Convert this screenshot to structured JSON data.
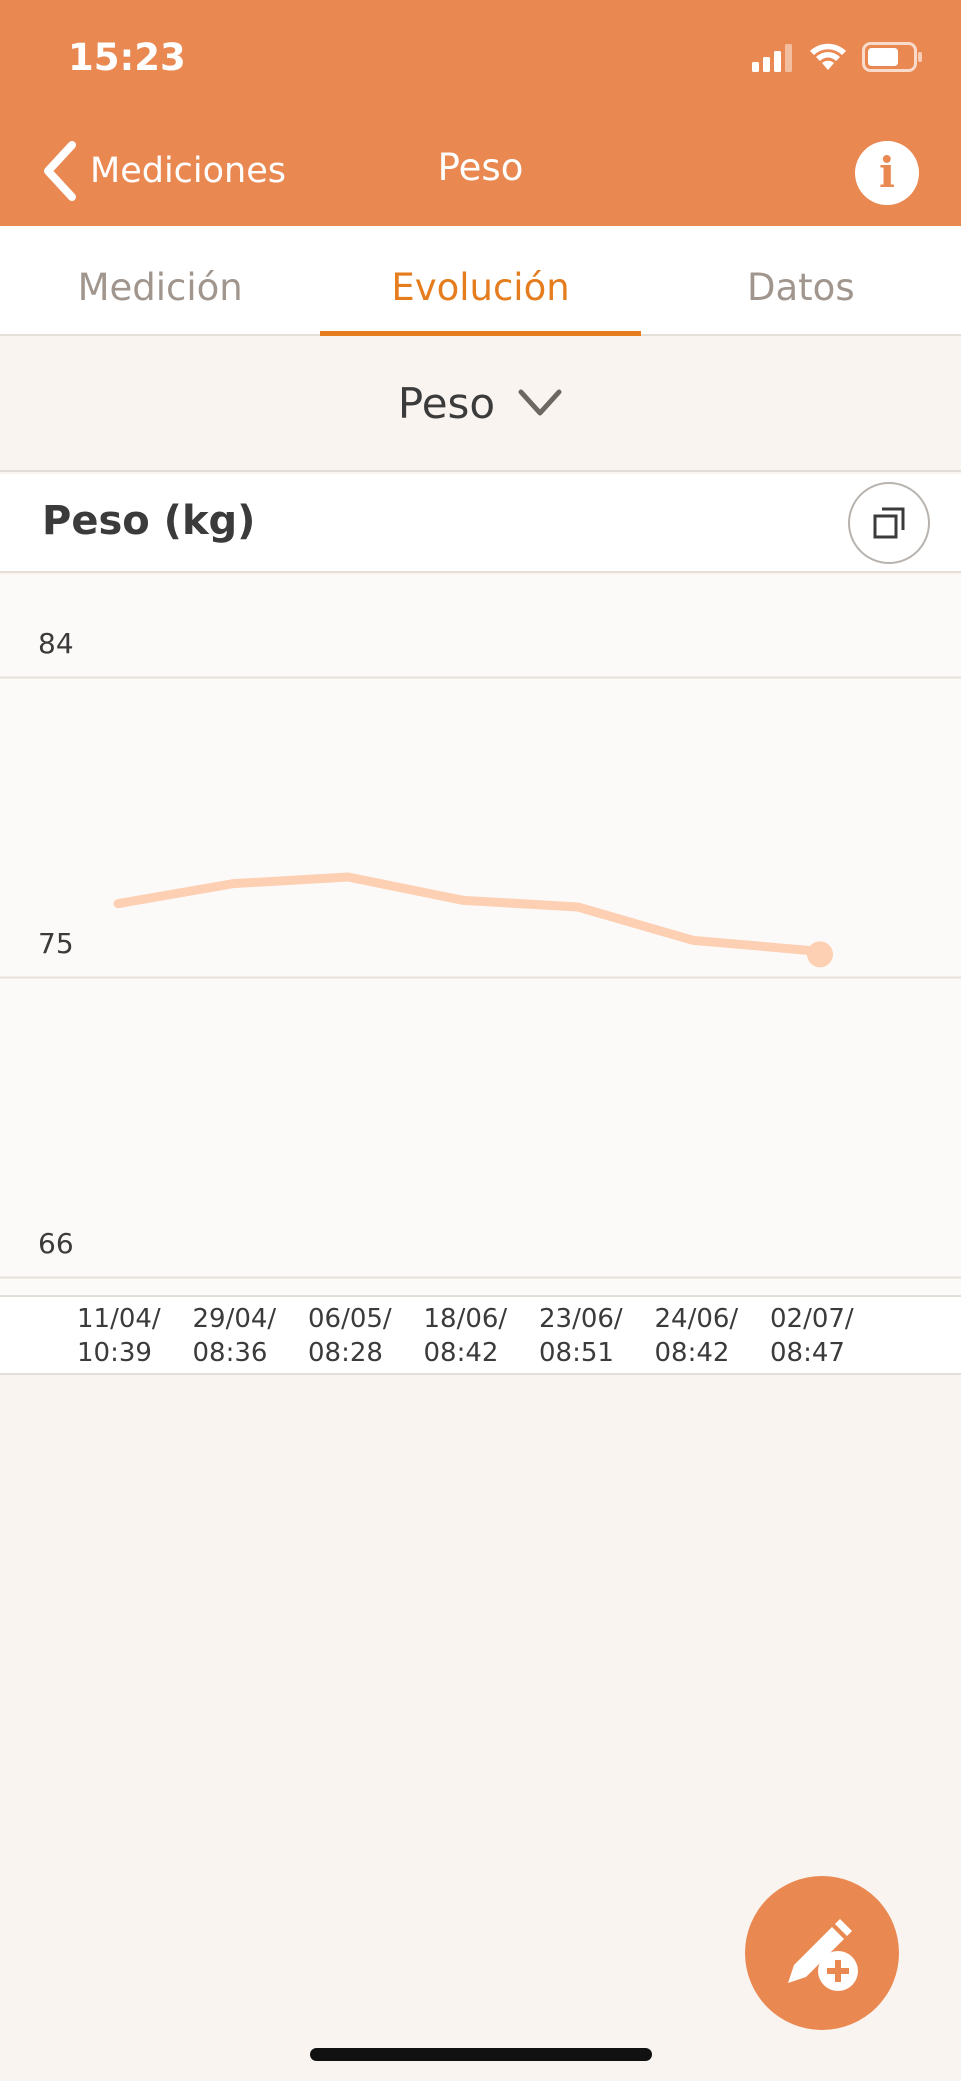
{
  "status_bar": {
    "time": "15:23"
  },
  "nav": {
    "back_label": "Mediciones",
    "title": "Peso"
  },
  "tabs": [
    {
      "label": "Medición",
      "active": false
    },
    {
      "label": "Evolución",
      "active": true
    },
    {
      "label": "Datos",
      "active": false
    }
  ],
  "selector": {
    "label": "Peso"
  },
  "chart_header": {
    "title": "Peso (kg)"
  },
  "colors": {
    "accent": "#ea8851",
    "active_tab": "#e57d1e",
    "series": "#fdcfb3"
  },
  "chart_data": {
    "type": "line",
    "ylim": [
      66,
      84
    ],
    "y_ticks": [
      "84",
      "75",
      "66"
    ],
    "categories": [
      [
        "11/04/",
        "10:39"
      ],
      [
        "29/04/",
        "08:36"
      ],
      [
        "06/05/",
        "08:28"
      ],
      [
        "18/06/",
        "08:42"
      ],
      [
        "23/06/",
        "08:51"
      ],
      [
        "24/06/",
        "08:42"
      ],
      [
        "02/07/",
        "08:47"
      ]
    ],
    "values": [
      77.2,
      77.8,
      78.0,
      77.3,
      77.1,
      76.1,
      75.8
    ]
  }
}
